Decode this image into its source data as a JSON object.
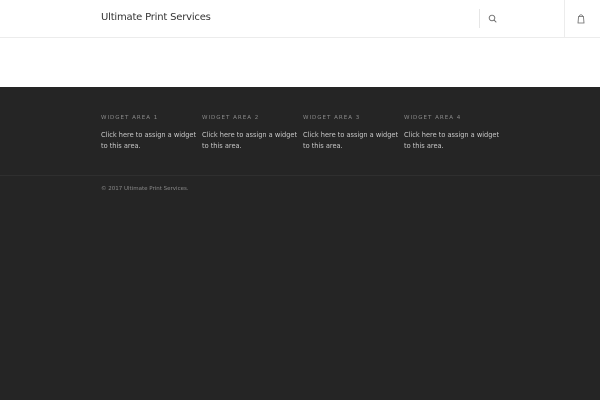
{
  "header": {
    "site_title": "Ultimate Print Services",
    "search_icon": "search-icon",
    "cart_icon": "shopping-bag-icon"
  },
  "footer": {
    "widgets": [
      {
        "title": "WIDGET AREA 1",
        "text": "Click here to assign a widget to this area."
      },
      {
        "title": "WIDGET AREA 2",
        "text": "Click here to assign a widget to this area."
      },
      {
        "title": "WIDGET AREA 3",
        "text": "Click here to assign a widget to this area."
      },
      {
        "title": "WIDGET AREA 4",
        "text": "Click here to assign a widget to this area."
      }
    ],
    "copyright": "© 2017 Ultimate Print Services."
  },
  "colors": {
    "header_bg": "#ffffff",
    "footer_bg": "#252525",
    "title_text": "#333333",
    "muted_text": "#8a8a8a",
    "body_text": "#c9c9c9"
  }
}
